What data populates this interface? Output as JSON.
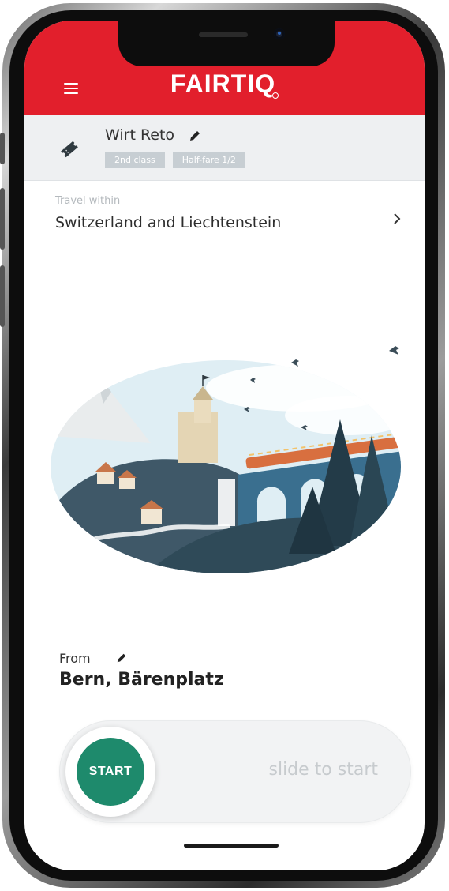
{
  "header": {
    "brand": "FAIRTIQ",
    "accent_color": "#e21f2c",
    "menu_icon": "hamburger-menu-icon"
  },
  "traveller": {
    "name": "Wirt Reto",
    "badges": [
      "2nd class",
      "Half-fare 1/2"
    ],
    "icon": "ticket-icon",
    "edit_icon": "pencil-icon"
  },
  "zone": {
    "label": "Travel within",
    "value": "Switzerland and Liechtenstein",
    "icon": "chevron-right-icon"
  },
  "from": {
    "label": "From",
    "value": "Bern, Bärenplatz",
    "edit_icon": "pencil-icon"
  },
  "slider": {
    "button_label": "START",
    "hint": "slide to start",
    "button_color": "#1e8a6c"
  }
}
